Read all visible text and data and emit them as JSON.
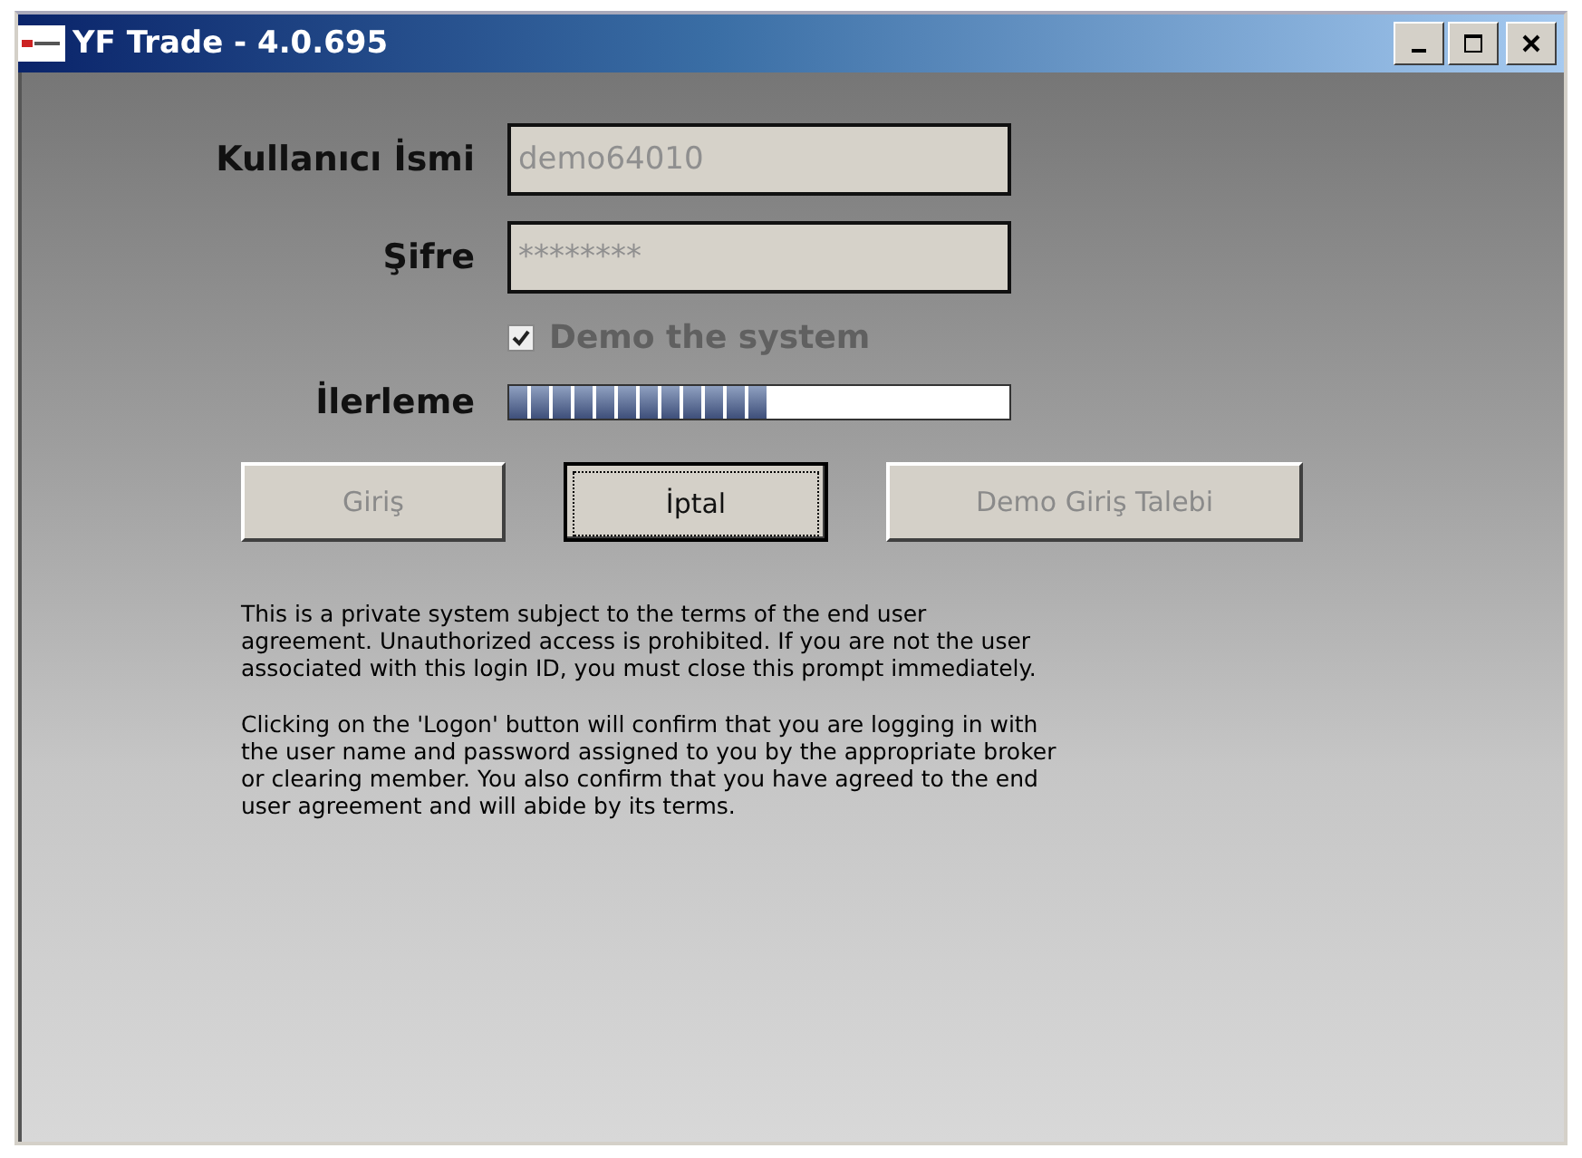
{
  "window": {
    "title": "YF Trade - 4.0.695"
  },
  "fields": [
    {
      "label": "Kullanıcı İsmi",
      "value": "demo64010",
      "disabled": true
    },
    {
      "label": "Şifre",
      "value": "********",
      "disabled": true
    }
  ],
  "demo_checkbox": {
    "label": "Demo the system",
    "checked": true,
    "disabled": true
  },
  "progress": {
    "label": "İlerleme",
    "level": 0.52
  },
  "buttons": [
    {
      "label": "Giriş",
      "disabled": true,
      "focused": false
    },
    {
      "label": "İptal",
      "disabled": false,
      "focused": true
    },
    {
      "label": "Demo Giriş Talebi",
      "disabled": true,
      "focused": false
    }
  ],
  "notice": [
    "This is a private system subject to the terms of the end user\nagreement. Unauthorized access is prohibited.  If you are not the user\nassociated with this login ID, you must close this prompt immediately.",
    "Clicking on the 'Logon' button will confirm that you are logging in with\nthe user name and password assigned to you by the appropriate broker\nor clearing member.  You also confirm that you have agreed to the end\nuser agreement and will abide by its terms."
  ]
}
